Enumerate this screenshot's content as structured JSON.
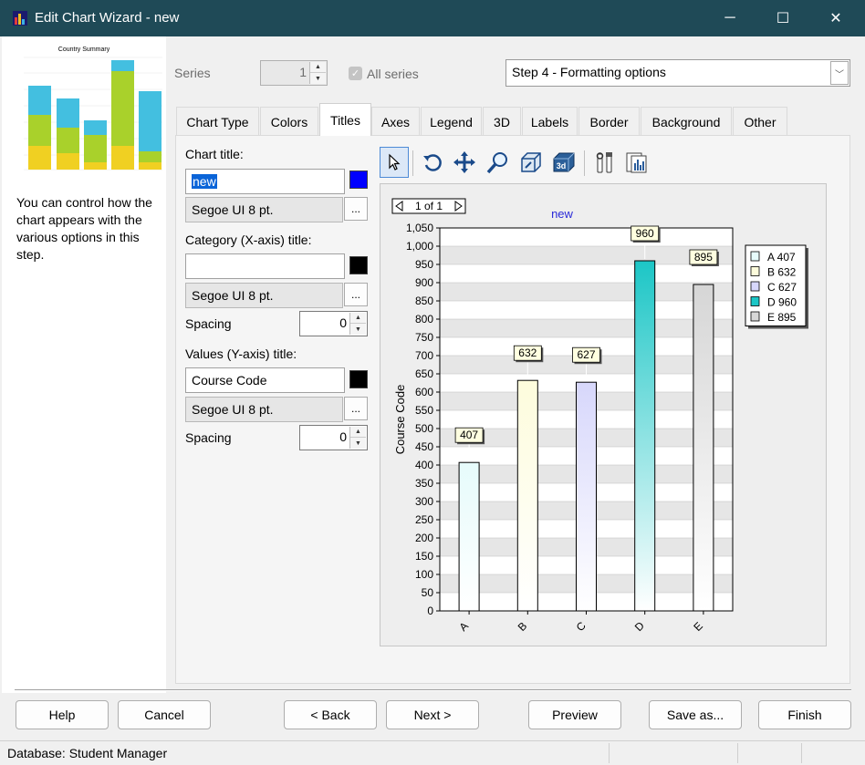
{
  "window": {
    "title": "Edit Chart Wizard - new",
    "minimize_glyph": "─",
    "maximize_glyph": "☐",
    "close_glyph": "✕"
  },
  "preview": {
    "thumbnail_title": "Country Summary",
    "description": "You can control how the chart appears with the various options in this step."
  },
  "series": {
    "label": "Series",
    "value": "1",
    "all_series_label": "All series",
    "all_series_checked": true,
    "step_value": "Step 4 - Formatting options"
  },
  "tabs": [
    {
      "label": "Chart Type"
    },
    {
      "label": "Colors"
    },
    {
      "label": "Titles"
    },
    {
      "label": "Axes"
    },
    {
      "label": "Legend"
    },
    {
      "label": "3D"
    },
    {
      "label": "Labels"
    },
    {
      "label": "Border"
    },
    {
      "label": "Background"
    },
    {
      "label": "Other"
    }
  ],
  "active_tab": "Titles",
  "titles": {
    "chart_title_label": "Chart title:",
    "chart_title_value": "new",
    "chart_title_color": "#0000ff",
    "chart_title_font": "Segoe UI 8 pt.",
    "category_label": "Category (X-axis) title:",
    "category_value": "",
    "category_color": "#000000",
    "category_font": "Segoe UI 8 pt.",
    "category_spacing_label": "Spacing",
    "category_spacing": "0",
    "values_label": "Values (Y-axis) title:",
    "values_value": "Course Code",
    "values_color": "#000000",
    "values_font": "Segoe UI 8 pt.",
    "values_spacing_label": "Spacing",
    "values_spacing": "0",
    "ellipsis": "..."
  },
  "toolbar": {
    "icons": [
      "pointer-icon",
      "rotate-icon",
      "move-icon",
      "zoom-icon",
      "depth-icon",
      "3d-icon",
      "edit-icon",
      "print-preview-icon"
    ]
  },
  "pager": {
    "text": "1 of 1"
  },
  "chart_data": {
    "type": "bar",
    "title": "new",
    "title_color": "#2a2ad8",
    "ylabel": "Course Code",
    "xlabel": "",
    "categories": [
      "A",
      "B",
      "C",
      "D",
      "E"
    ],
    "values": [
      407,
      632,
      627,
      960,
      895
    ],
    "colors": [
      "#e6fbfb",
      "#fdfcdc",
      "#d7d7fb",
      "#1cc6c6",
      "#d6d6d6"
    ],
    "ylim": [
      0,
      1050
    ],
    "yticks": [
      "0",
      "50",
      "100",
      "150",
      "200",
      "250",
      "300",
      "350",
      "400",
      "450",
      "500",
      "550",
      "600",
      "650",
      "700",
      "750",
      "800",
      "850",
      "900",
      "950",
      "1,000",
      "1,050"
    ],
    "data_labels": [
      "407",
      "632",
      "627",
      "960",
      "895"
    ],
    "legend": [
      "A 407",
      "B 632",
      "C 627",
      "D 960",
      "E 895"
    ],
    "legend_position": "right",
    "grid": true
  },
  "buttons": {
    "help": "Help",
    "cancel": "Cancel",
    "back": "< Back",
    "next": "Next >",
    "preview": "Preview",
    "save_as": "Save as...",
    "finish": "Finish"
  },
  "status": {
    "text": "Database: Student Manager"
  }
}
